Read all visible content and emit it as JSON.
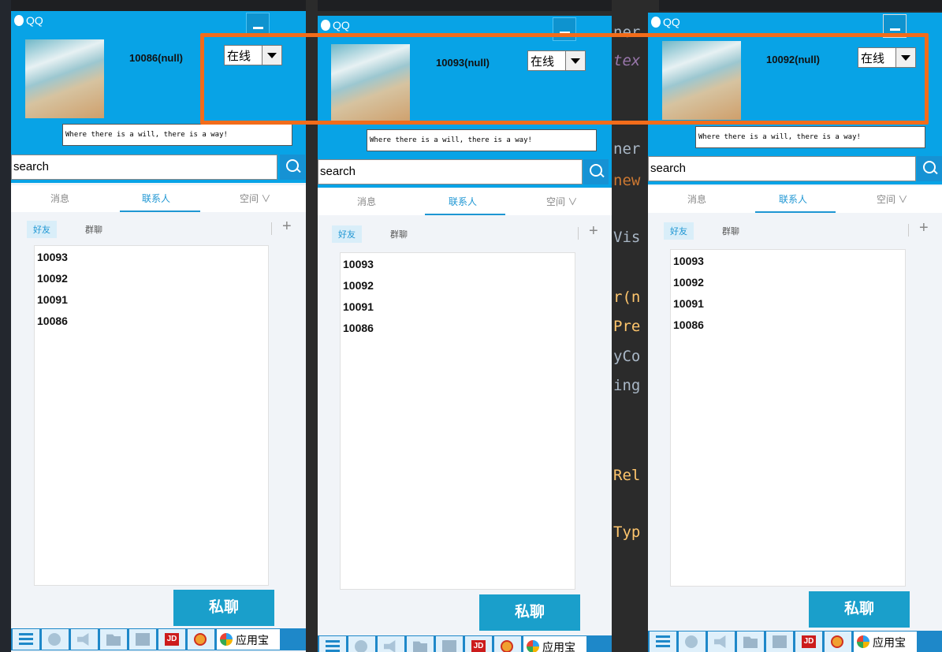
{
  "windows": [
    {
      "app_title": "QQ",
      "user_id": "10086(null)",
      "status": "在线",
      "signature": "Where there is a will, there is a way!",
      "search_placeholder": "search",
      "tabs": [
        "消息",
        "联系人",
        "空间 ∨"
      ],
      "subtabs": [
        "好友",
        "群聊"
      ],
      "friends": [
        "10093",
        "10092",
        "10091",
        "10086"
      ],
      "chat_button": "私聊",
      "taskbar": {
        "jd": "JD",
        "app_store": "应用宝"
      }
    },
    {
      "app_title": "QQ",
      "user_id": "10093(null)",
      "status": "在线",
      "signature": "Where there is a will, there is a way!",
      "search_placeholder": "search",
      "tabs": [
        "消息",
        "联系人",
        "空间 ∨"
      ],
      "subtabs": [
        "好友",
        "群聊"
      ],
      "friends": [
        "10093",
        "10092",
        "10091",
        "10086"
      ],
      "chat_button": "私聊",
      "taskbar": {
        "jd": "JD",
        "app_store": "应用宝"
      }
    },
    {
      "app_title": "QQ",
      "user_id": "10092(null)",
      "status": "在线",
      "signature": "Where there is a will, there is a way!",
      "search_placeholder": "search",
      "tabs": [
        "消息",
        "联系人",
        "空间 ∨"
      ],
      "subtabs": [
        "好友",
        "群聊"
      ],
      "friends": [
        "10093",
        "10092",
        "10091",
        "10086"
      ],
      "chat_button": "私聊",
      "taskbar": {
        "jd": "JD",
        "app_store": "应用宝"
      }
    }
  ],
  "code_fragments": [
    "ner",
    "tex",
    "ner",
    "new",
    "Vis",
    "r(n",
    "Pre",
    "yCo",
    "ing",
    "Rel",
    "Typ"
  ],
  "colors": {
    "qq_blue": "#08a3e6",
    "highlight_border": "#f26c1a",
    "chat_button": "#1a9fcb"
  }
}
